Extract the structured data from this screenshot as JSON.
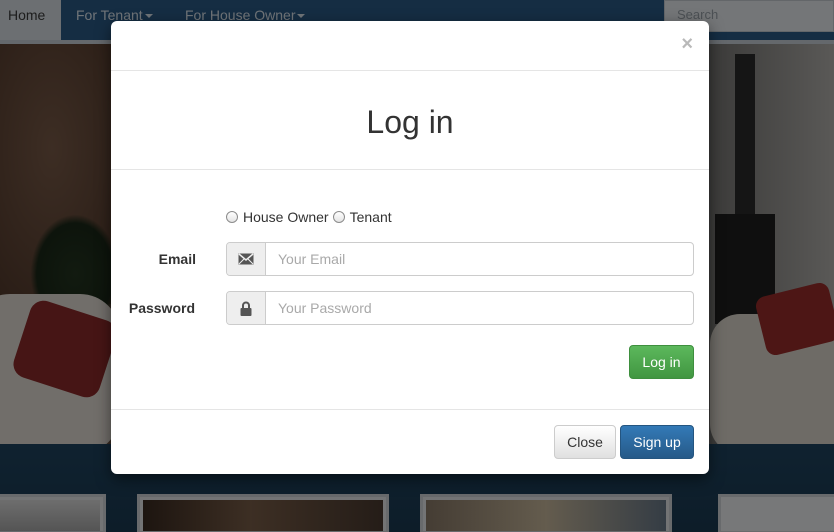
{
  "nav": {
    "home": "Home",
    "tenant": "For Tenant",
    "owner": "For House Owner",
    "search_placeholder": "Search"
  },
  "modal": {
    "close_symbol": "×",
    "title": "Log in",
    "roles": [
      "House Owner",
      "Tenant"
    ],
    "email_label": "Email",
    "email_placeholder": "Your Email",
    "email_icon": "envelope-icon",
    "password_label": "Password",
    "password_placeholder": "Your Password",
    "password_icon": "lock-icon",
    "login_button": "Log in",
    "close_button": "Close",
    "signup_button": "Sign up"
  },
  "colors": {
    "navbar": "#2a5a86",
    "login_button": "#5cb85c",
    "signup_button": "#337ab7"
  }
}
